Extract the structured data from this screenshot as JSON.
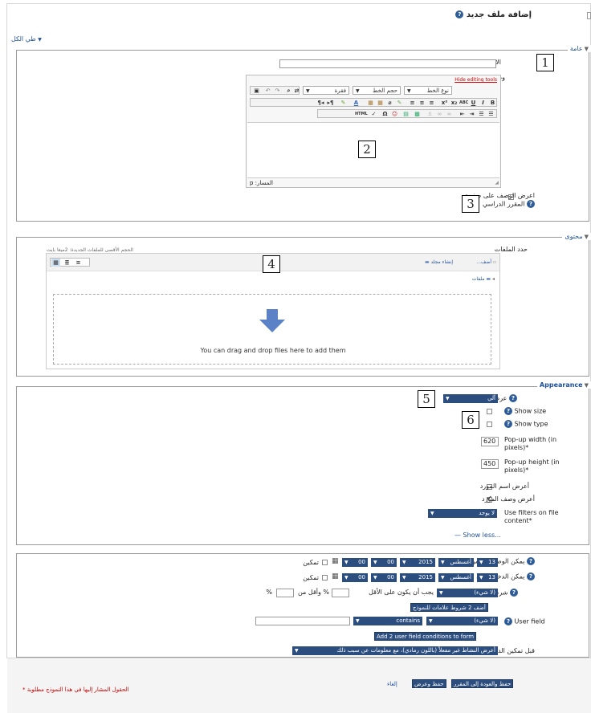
{
  "page": {
    "title": "إضافة ملف جديد",
    "collapse_all": "طي الكل"
  },
  "general": {
    "legend": "عامة",
    "name_label": "الاسم",
    "description_label": "وصف",
    "hide_editing_tools": "Hide editing tools",
    "font_family": "نوع الخط",
    "font_size": "حجم الخط",
    "paragraph": "فقرة",
    "path_label": "المسار: p",
    "show_description_label_1": "اعرض الوصف على صفحة",
    "show_description_label_2": "المقرر الدراسي"
  },
  "content": {
    "legend": "محتوى",
    "select_files_label": "حدد الملفات",
    "max_size": "الحجم الأقصى للملفات الجديدة: 2ميغا بايت",
    "add_label": "أضف...",
    "create_folder": "إنشاء مجلد",
    "files_breadcrumb": "ملفات",
    "drop_text": "You can drag and drop files here to add them"
  },
  "appearance": {
    "legend": "Appearance",
    "display_label": "عرض",
    "display_value": "آلي",
    "show_size": "Show size",
    "show_type": "Show type",
    "popup_width_label": "Pop-up width (in",
    "popup_width_label2": "pixels)*",
    "popup_width_value": "620",
    "popup_height_label": "Pop-up height (in",
    "popup_height_label2": "pixels)*",
    "popup_height_value": "450",
    "show_resource_name": "أعرض اسم المورد",
    "show_resource_description": "أعرض وصف المورد",
    "use_filters_label": "Use filters on file",
    "use_filters_label2": "content*",
    "use_filters_value": "لا يوجد",
    "show_less": "Show less..."
  },
  "restrict": {
    "available_from_label": "يمكن الوصول له من",
    "available_until_label": "يمكن الدخول حتى",
    "day": "13",
    "month": "أغسطس",
    "year": "2015",
    "hour": "00",
    "minute": "00",
    "enable": "تمكين",
    "grade_condition_label": "شرط العلامة",
    "grade_none": "(لا شيء)",
    "must_be_at_least": "يجب أن يكون على الأقل",
    "and_less_than": "% وأقل من",
    "percent": "%",
    "add_grade_conditions": "أضف 2 شروط علامات للنموذج",
    "user_field_label": "User field",
    "user_field_none": "(لا شيء)",
    "operator": "contains",
    "add_user_field_conditions": "Add 2 user field conditions to form",
    "before_access_label": "قبل تمكين الدخول إلى النشاط",
    "before_access_value": "أعرض النشاط غير مفعلاً (باللون رمادي)، مع معلومات عن سبب ذلك"
  },
  "buttons": {
    "save_return": "حفظ والعودة إلى المقرر",
    "save_display": "حفظ وعرض",
    "cancel": "إلغاء"
  },
  "footer": {
    "required_note": "الحقول المشار إليها في هذا النموذج مطلوبة"
  },
  "callouts": [
    "1",
    "2",
    "3",
    "4",
    "5",
    "6"
  ]
}
